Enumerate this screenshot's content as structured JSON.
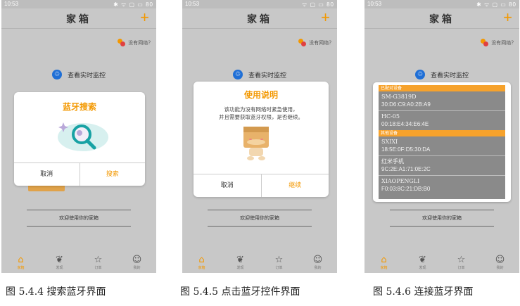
{
  "colors": {
    "accent": "#f39800",
    "blue": "#1f6fd6"
  },
  "phones": [
    {
      "status_time": "10:53",
      "status_icons": "✱ ᯤ ▢ ▭ 80",
      "title": "家箱",
      "plus": "+",
      "net_status": "没有网络?",
      "monitor_label": "查看实时监控",
      "welcome": "欢迎使用你的家箱",
      "dialog": {
        "title": "蓝牙搜索",
        "illustration": "search-illustration",
        "cancel": "取消",
        "confirm": "搜索"
      },
      "caption": "图 5.4.4 搜索蓝牙界面"
    },
    {
      "status_time": "10:53",
      "status_icons": "ᯤ ▢ ▭ 80",
      "title": "家箱",
      "plus": "+",
      "net_status": "没有网络?",
      "monitor_label": "查看实时监控",
      "welcome": "欢迎使用你的家箱",
      "dialog": {
        "title": "使用说明",
        "body_line1": "该功能为没有网络时紧急使用，",
        "body_line2": "并且需要获取蓝牙权限，是否继续。",
        "illustration": "box-mascot",
        "cancel": "取消",
        "confirm": "继续"
      },
      "caption": "图 5.4.5 点击蓝牙控件界面"
    },
    {
      "status_time": "10:53",
      "status_icons": "✱ ᯤ ▢ ▭ 80",
      "title": "家箱",
      "plus": "+",
      "net_status": "没有网络?",
      "monitor_label": "查看实时监控",
      "welcome": "欢迎使用你的家箱",
      "paired_header": "已配对设备",
      "available_header": "其他设备",
      "paired": [
        {
          "name": "SM-G3819D",
          "mac": "30:D6:C9:A0:2B:A9"
        },
        {
          "name": "HC-05",
          "mac": "00:18:E4:34:E6:4E"
        }
      ],
      "available": [
        {
          "name": "SXIXI",
          "mac": "18:5E:0F:D5:30:DA"
        },
        {
          "name": "红米手机",
          "mac": "9C:2E:A1:71:0E:2C"
        },
        {
          "name": "XIAOPENGLI",
          "mac": "F0:03:8C:21:DB:B0"
        }
      ],
      "caption": "图 5.4.6 连接蓝牙界面"
    }
  ],
  "tabs": [
    "家箱",
    "发现",
    "订单",
    "我的"
  ],
  "tab_icons": [
    "home-icon",
    "leaf-icon",
    "star-box-icon",
    "smile-icon"
  ]
}
